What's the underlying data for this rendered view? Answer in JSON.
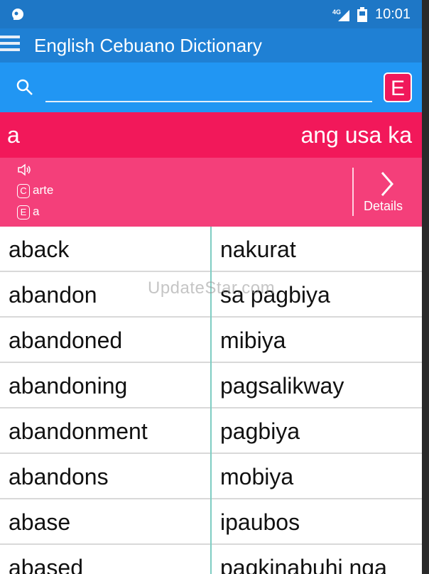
{
  "status_bar": {
    "network": "4G",
    "time": "10:01",
    "icons": [
      "notification-icon",
      "signal-icon",
      "battery-icon"
    ]
  },
  "app_bar": {
    "title": "English Cebuano Dictionary",
    "menu_icon": "menu-icon"
  },
  "search": {
    "placeholder": "",
    "value": "",
    "language_button": "E",
    "search_icon": "search-icon"
  },
  "selected": {
    "word": "a",
    "translation": "ang usa ka",
    "cebuano_badge": "C",
    "cebuano_text": "arte",
    "english_badge": "E",
    "english_text": "a",
    "details_label": "Details",
    "speaker_icon": "speaker-icon",
    "details_icon": "chevron-right-icon"
  },
  "entries": [
    {
      "english": "aback",
      "cebuano": "nakurat"
    },
    {
      "english": "abandon",
      "cebuano": "sa pagbiya"
    },
    {
      "english": "abandoned",
      "cebuano": "mibiya"
    },
    {
      "english": "abandoning",
      "cebuano": "pagsalikway"
    },
    {
      "english": "abandonment",
      "cebuano": "pagbiya"
    },
    {
      "english": "abandons",
      "cebuano": "mobiya"
    },
    {
      "english": "abase",
      "cebuano": "ipaubos"
    },
    {
      "english": "abased",
      "cebuano": "pagkinabuhi nga"
    }
  ],
  "watermark": "UpdateStar.com",
  "colors": {
    "status_bar": "#1e77c6",
    "app_bar": "#1f80d4",
    "search_bar": "#2196f3",
    "banner": "#f2185a",
    "detail_panel": "#f43f7a",
    "divider": "#7fcdc3"
  }
}
